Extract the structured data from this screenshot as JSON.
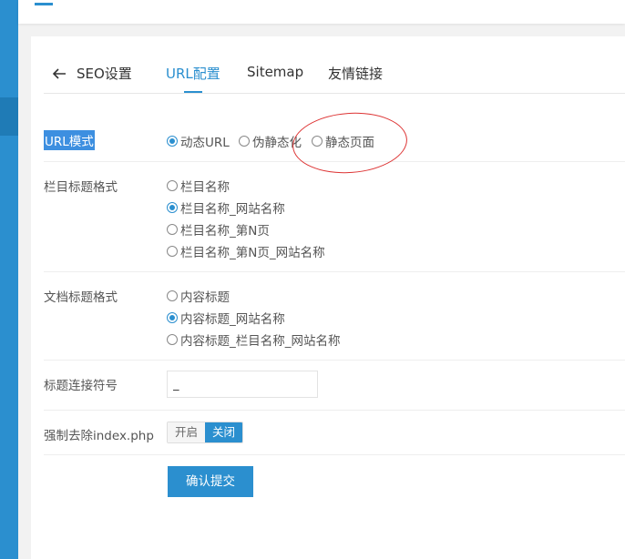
{
  "tabs": {
    "seo": "SEO设置",
    "url": "URL配置",
    "sitemap": "Sitemap",
    "links": "友情链接"
  },
  "url_mode": {
    "label": "URL模式",
    "options": [
      "动态URL",
      "伪静态化",
      "静态页面"
    ],
    "selected": "动态URL"
  },
  "column_title_format": {
    "label": "栏目标题格式",
    "options": [
      "栏目名称",
      "栏目名称_网站名称",
      "栏目名称_第N页",
      "栏目名称_第N页_网站名称"
    ],
    "selected": "栏目名称_网站名称"
  },
  "doc_title_format": {
    "label": "文档标题格式",
    "options": [
      "内容标题",
      "内容标题_网站名称",
      "内容标题_栏目名称_网站名称"
    ],
    "selected": "内容标题_网站名称"
  },
  "title_connector": {
    "label": "标题连接符号",
    "value": "_"
  },
  "force_remove_index": {
    "label": "强制去除index.php",
    "on_label": "开启",
    "off_label": "关闭",
    "selected": "关闭"
  },
  "submit_label": "确认提交",
  "colors": {
    "accent": "#2b8fcf",
    "annotation": "#dd3333"
  }
}
